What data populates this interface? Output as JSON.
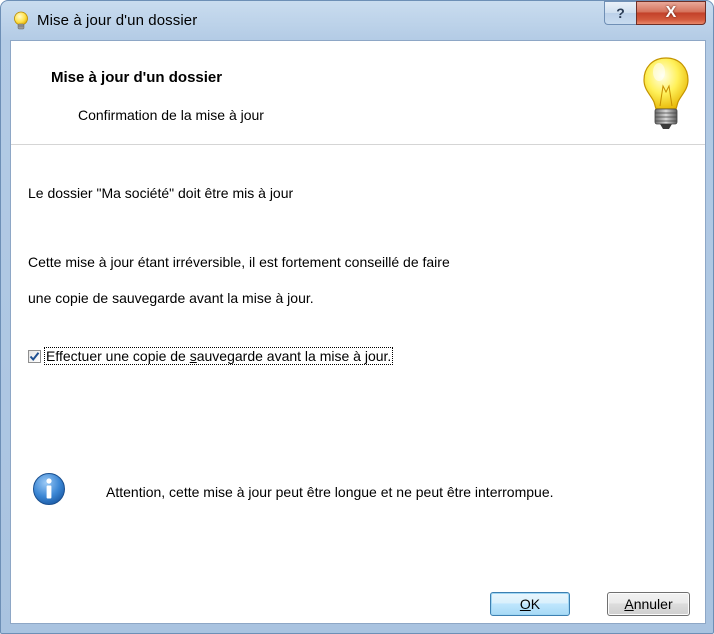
{
  "window": {
    "title": "Mise à jour d'un dossier",
    "help_button": "?",
    "close_button": "X"
  },
  "header": {
    "title": "Mise à jour d'un dossier",
    "subtitle": "Confirmation de la mise à jour"
  },
  "content": {
    "line1": "Le dossier \"Ma société\" doit être mis à jour",
    "line2": "Cette mise à jour étant irréversible, il est fortement conseillé de faire",
    "line3": "une copie de sauvegarde avant la mise à jour.",
    "checkbox": {
      "label_before": "Effectuer une copie de ",
      "label_accel": "s",
      "label_after": "auvegarde avant la mise à jour.",
      "checked": true
    },
    "info_text": "Attention, cette mise à jour peut être longue et ne peut être interrompue."
  },
  "buttons": {
    "ok_accel": "O",
    "ok_rest": "K",
    "cancel_accel": "A",
    "cancel_rest": "nnuler"
  },
  "icons": {
    "title_icon": "lightbulb-icon",
    "header_icon": "lightbulb-icon",
    "info_icon": "info-icon"
  },
  "colors": {
    "titlebar": "#b3cbe5",
    "close_button": "#c3412a",
    "ok_border": "#3c7fb1",
    "info_icon": "#2a6fb8"
  }
}
